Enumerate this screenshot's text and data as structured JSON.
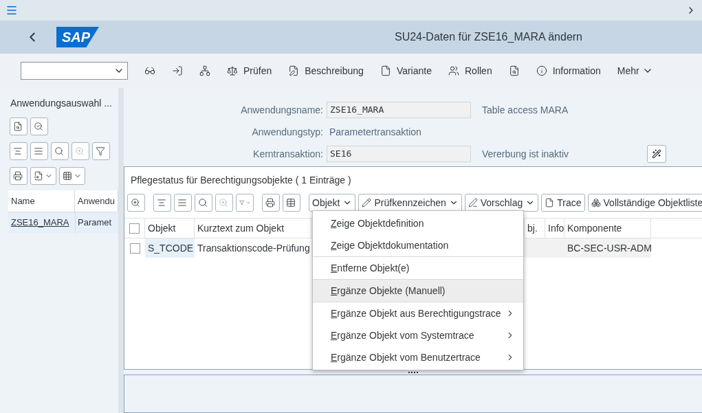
{
  "header": {
    "title": "SU24-Daten für ZSE16_MARA ändern",
    "logo": "SAP"
  },
  "toolbar": {
    "items": [
      {
        "kind": "icon"
      },
      {
        "kind": "icon"
      },
      {
        "kind": "icon"
      },
      {
        "kind": "text",
        "label": "Prüfen"
      },
      {
        "kind": "text",
        "label": "Beschreibung"
      },
      {
        "kind": "text",
        "label": "Variante"
      },
      {
        "kind": "text",
        "label": "Rollen"
      },
      {
        "kind": "icon"
      },
      {
        "kind": "text",
        "label": "Information"
      },
      {
        "kind": "more",
        "label": "Mehr"
      }
    ]
  },
  "sidebar": {
    "title": "Anwendungsauswahl ...",
    "columns": [
      "Name",
      "Anwendu"
    ],
    "rows": [
      {
        "name": "ZSE16_MARA",
        "type": "Paramet",
        "selected": true
      }
    ]
  },
  "form": {
    "rows": [
      {
        "label": "Anwendungsname:",
        "kind": "field",
        "value": "ZSE16_MARA",
        "note": "Table access MARA"
      },
      {
        "label": "Anwendungstyp:",
        "kind": "text",
        "value": "Parametertransaktion"
      },
      {
        "label": "Kerntransaktion:",
        "kind": "field",
        "value": "SE16",
        "note": "Vererbung ist inaktiv"
      }
    ]
  },
  "panel": {
    "title": "Pflegestatus für Berechtigungsobjekte ( 1 Einträge )",
    "buttons": [
      {
        "label": "Objekt",
        "dropdown": true
      },
      {
        "label": "Prüfkennzeichen",
        "dropdown": true
      },
      {
        "label": "Vorschlag",
        "dropdown": true
      },
      {
        "label": "Trace",
        "dropdown": false
      },
      {
        "label": "Vollständige Objektliste",
        "dropdown": false
      }
    ],
    "table": {
      "all_selected": false,
      "columns": [
        "Objekt",
        "Kurztext zum Objekt",
        "bj.",
        "Info",
        "Komponente"
      ],
      "rows": [
        {
          "selected": false,
          "cells": [
            "S_TCODE",
            "Transaktionscode-Prüfung",
            "",
            "",
            "BC-SEC-USR-ADM"
          ]
        }
      ]
    }
  },
  "menu": {
    "items": [
      {
        "label": "Zeige Objektdefinition",
        "submenu": false,
        "selected": false
      },
      {
        "label": "Zeige Objektdokumentation",
        "submenu": false,
        "selected": false
      },
      {
        "label": "Entferne Objekt(e)",
        "submenu": false,
        "selected": false
      },
      {
        "label": "Ergänze Objekte (Manuell)",
        "submenu": false,
        "selected": true
      },
      {
        "label": "Ergänze Objekt aus Berechtigungstrace",
        "submenu": true,
        "selected": false
      },
      {
        "label": "Ergänze Objekt vom Systemtrace",
        "submenu": true,
        "selected": false
      },
      {
        "label": "Ergänze Objekt vom Benutzertrace",
        "submenu": true,
        "selected": false
      }
    ]
  }
}
